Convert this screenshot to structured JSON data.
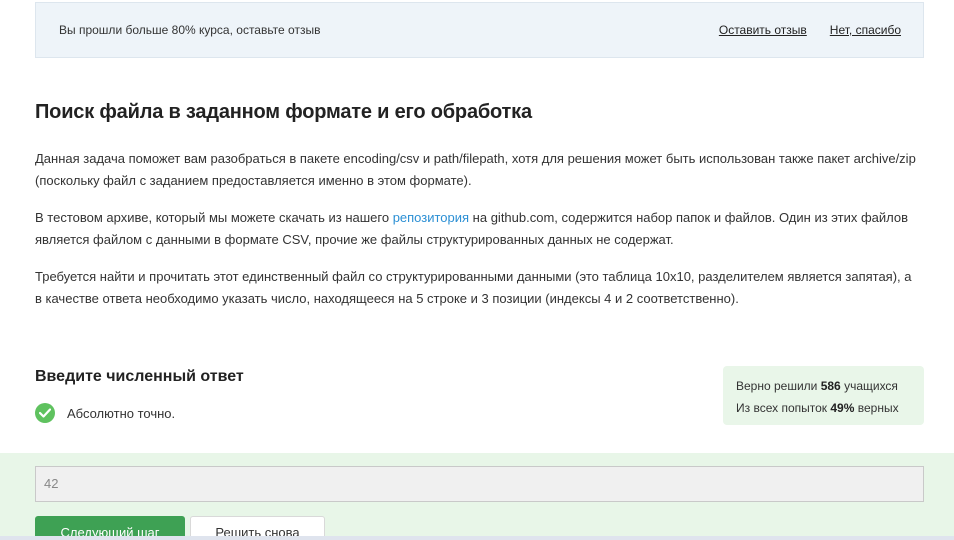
{
  "banner": {
    "text": "Вы прошли больше 80% курса, оставьте отзыв",
    "leave_review": "Оставить отзыв",
    "no_thanks": "Нет, спасибо"
  },
  "task": {
    "title": "Поиск файла в заданном формате и его обработка",
    "p1": "Данная задача поможет вам разобраться в пакете encoding/csv и path/filepath, хотя для решения может быть использован также пакет archive/zip (поскольку файл с заданием предоставляется именно в этом формате).",
    "p2_before": "В тестовом архиве, который мы можете скачать из нашего ",
    "p2_link": "репозитория",
    "p2_after": " на github.com, содержится набор папок и файлов. Один из этих файлов является файлом с данными в формате CSV, прочие же файлы структурированных данных не содержат.",
    "p3": "Требуется найти и прочитать этот единственный файл со структурированными данными (это таблица 10x10, разделителем является запятая), а в качестве ответа необходимо указать число, находящееся на 5 строке и 3 позиции (индексы 4 и 2 соответственно)."
  },
  "answer": {
    "title": "Введите численный ответ",
    "result_text": "Абсолютно точно.",
    "input_value": "42",
    "next_button": "Следующий шаг",
    "retry_button": "Решить снова"
  },
  "stats": {
    "solved_prefix": "Верно решили ",
    "solved_count": "586",
    "solved_suffix": " учащихся",
    "attempts_prefix": "Из всех попыток ",
    "attempts_percent": "49%",
    "attempts_suffix": " верных"
  },
  "colors": {
    "link": "#2b8fd4",
    "success_green": "#5fc25f",
    "button_green": "#3ea154",
    "banner_bg": "#eef4f9",
    "answer_zone_bg": "#e8f6e8"
  },
  "icons": {
    "result": "check-circle-icon"
  }
}
